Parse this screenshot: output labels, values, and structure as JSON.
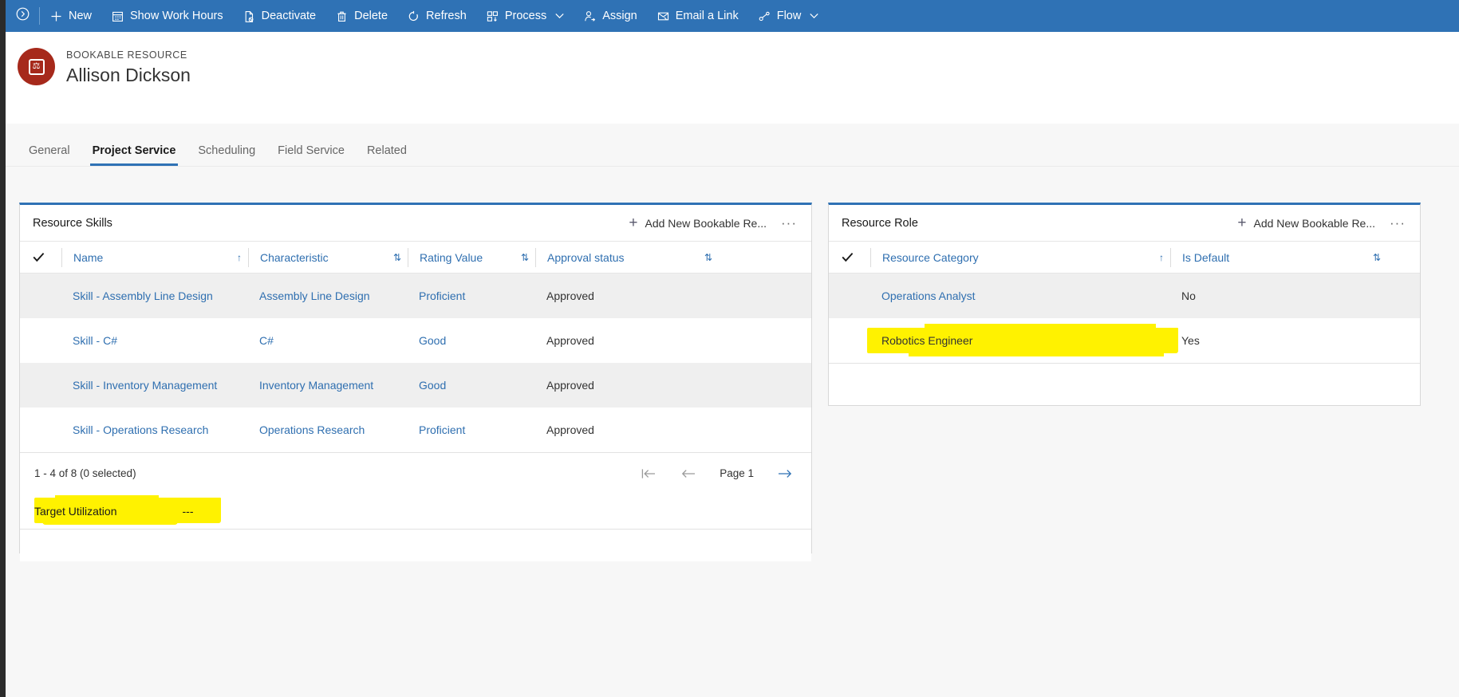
{
  "commandbar": {
    "expand_icon": "chevron-circle-right-icon",
    "items": [
      {
        "label": "New",
        "icon": "plus-icon",
        "chevron": false
      },
      {
        "label": "Show Work Hours",
        "icon": "calendar-icon",
        "chevron": false
      },
      {
        "label": "Deactivate",
        "icon": "document-off-icon",
        "chevron": false
      },
      {
        "label": "Delete",
        "icon": "trash-icon",
        "chevron": false
      },
      {
        "label": "Refresh",
        "icon": "refresh-icon",
        "chevron": false
      },
      {
        "label": "Process",
        "icon": "process-icon",
        "chevron": true
      },
      {
        "label": "Assign",
        "icon": "person-arrow-icon",
        "chevron": true
      },
      {
        "label": "Email a Link",
        "icon": "email-link-icon",
        "chevron": false
      },
      {
        "label": "Flow",
        "icon": "flow-icon",
        "chevron": true
      }
    ]
  },
  "record": {
    "entity_label": "BOOKABLE RESOURCE",
    "title": "Allison Dickson",
    "avatar_icon": "bookable-resource-icon",
    "avatar_color": "#a6291b"
  },
  "tabs": [
    {
      "label": "General",
      "active": false
    },
    {
      "label": "Project Service",
      "active": true
    },
    {
      "label": "Scheduling",
      "active": false
    },
    {
      "label": "Field Service",
      "active": false
    },
    {
      "label": "Related",
      "active": false
    }
  ],
  "skills_panel": {
    "title": "Resource Skills",
    "add_label": "Add New Bookable Re...",
    "add_icon": "plus-icon",
    "more_icon": "ellipsis-icon",
    "select_all_icon": "checkmark-icon",
    "columns": [
      {
        "label": "Name",
        "sort": "ascending-icon"
      },
      {
        "label": "Characteristic",
        "sort": "sortable-icon"
      },
      {
        "label": "Rating Value",
        "sort": "sortable-icon"
      },
      {
        "label": "Approval status",
        "sort": "sortable-icon"
      }
    ],
    "rows": [
      {
        "name": "Skill - Assembly Line Design",
        "characteristic": "Assembly Line Design",
        "rating": "Proficient",
        "approval": "Approved"
      },
      {
        "name": "Skill - C#",
        "characteristic": "C#",
        "rating": "Good",
        "approval": "Approved"
      },
      {
        "name": "Skill - Inventory Management",
        "characteristic": "Inventory Management",
        "rating": "Good",
        "approval": "Approved"
      },
      {
        "name": "Skill - Operations Research",
        "characteristic": "Operations Research",
        "rating": "Proficient",
        "approval": "Approved"
      }
    ],
    "footer": {
      "count_text": "1 - 4 of 8 (0 selected)",
      "page_label": "Page 1",
      "first_icon": "first-page-icon",
      "prev_icon": "previous-page-icon",
      "next_icon": "next-page-icon"
    }
  },
  "target_utilization": {
    "label": "Target Utilization",
    "value": "---",
    "highlighted": true
  },
  "role_panel": {
    "title": "Resource Role",
    "add_label": "Add New Bookable Re...",
    "add_icon": "plus-icon",
    "more_icon": "ellipsis-icon",
    "select_all_icon": "checkmark-icon",
    "columns": [
      {
        "label": "Resource Category",
        "sort": "ascending-icon"
      },
      {
        "label": "Is Default",
        "sort": "sortable-icon"
      }
    ],
    "rows": [
      {
        "category": "Operations Analyst",
        "is_default": "No",
        "highlighted": false
      },
      {
        "category": "Robotics Engineer",
        "is_default": "Yes",
        "highlighted": true
      }
    ]
  },
  "colors": {
    "command_bar": "#2f72b5",
    "accent": "#2f72b5",
    "link": "#2f6fb0",
    "highlight": "#fff200",
    "canvas": "#f7f7f7",
    "row_alt": "#efefef"
  }
}
